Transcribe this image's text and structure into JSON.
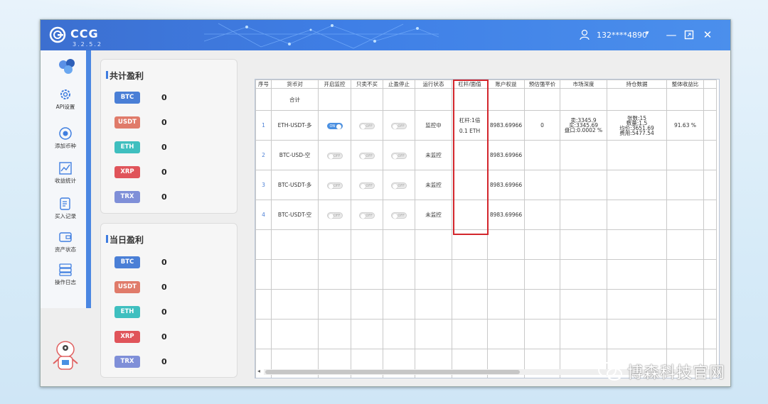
{
  "app": {
    "name": "CCG",
    "version": "3.2.5.2",
    "user": "132****4890"
  },
  "sidebar": {
    "items": [
      {
        "label": "API设置",
        "icon": "gear-icon"
      },
      {
        "label": "添加币种",
        "icon": "add-coin-icon"
      },
      {
        "label": "收益统计",
        "icon": "chart-icon"
      },
      {
        "label": "买入记录",
        "icon": "record-icon"
      },
      {
        "label": "资产状态",
        "icon": "wallet-icon"
      },
      {
        "label": "操作日志",
        "icon": "log-icon"
      }
    ]
  },
  "total_profit": {
    "title": "共计盈利",
    "items": [
      {
        "coin": "BTC",
        "value": "0",
        "color": "#4a7fd6"
      },
      {
        "coin": "USDT",
        "value": "0",
        "color": "#e07b6a"
      },
      {
        "coin": "ETH",
        "value": "0",
        "color": "#3fbfbf"
      },
      {
        "coin": "XRP",
        "value": "0",
        "color": "#e0545a"
      },
      {
        "coin": "TRX",
        "value": "0",
        "color": "#7f8fd8"
      }
    ]
  },
  "daily_profit": {
    "title": "当日盈利",
    "items": [
      {
        "coin": "BTC",
        "value": "0",
        "color": "#4a7fd6"
      },
      {
        "coin": "USDT",
        "value": "0",
        "color": "#e07b6a"
      },
      {
        "coin": "ETH",
        "value": "0",
        "color": "#3fbfbf"
      },
      {
        "coin": "XRP",
        "value": "0",
        "color": "#e0545a"
      },
      {
        "coin": "TRX",
        "value": "0",
        "color": "#7f8fd8"
      }
    ]
  },
  "table": {
    "headers": [
      "序号",
      "货币对",
      "开启监控",
      "只卖不买",
      "止盈停止",
      "运行状态",
      "杠杆/面值",
      "账户权益",
      "预估强平价",
      "市场深度",
      "持仓数据",
      "整体收益比"
    ],
    "summary_label": "合计",
    "rows": [
      {
        "no": "1",
        "pair": "ETH-USDT-多",
        "monitor": "ON",
        "sell_only": "OFF",
        "tp_stop": "OFF",
        "status": "监控中",
        "leverage": "杠杆:1倍",
        "face": "0.1 ETH",
        "equity": "8983.69966",
        "liq": "0",
        "depth": [
          "卖:3345.9",
          "买:3345.69",
          "盘口:0.0002 %"
        ],
        "position": [
          "张数:15",
          "数量:1.5",
          "均价:3651.69",
          "费用:5477.54"
        ],
        "ratio": "91.63 %"
      },
      {
        "no": "2",
        "pair": "BTC-USD-空",
        "monitor": "OFF",
        "sell_only": "OFF",
        "tp_stop": "OFF",
        "status": "未监控",
        "leverage": "",
        "face": "",
        "equity": "8983.69966",
        "liq": "",
        "depth": [],
        "position": [],
        "ratio": ""
      },
      {
        "no": "3",
        "pair": "BTC-USDT-多",
        "monitor": "OFF",
        "sell_only": "OFF",
        "tp_stop": "OFF",
        "status": "未监控",
        "leverage": "",
        "face": "",
        "equity": "8983.69966",
        "liq": "",
        "depth": [],
        "position": [],
        "ratio": ""
      },
      {
        "no": "4",
        "pair": "BTC-USDT-空",
        "monitor": "OFF",
        "sell_only": "OFF",
        "tp_stop": "OFF",
        "status": "未监控",
        "leverage": "",
        "face": "",
        "equity": "8983.69966",
        "liq": "",
        "depth": [],
        "position": [],
        "ratio": ""
      }
    ]
  },
  "watermark": "博森科技官网"
}
